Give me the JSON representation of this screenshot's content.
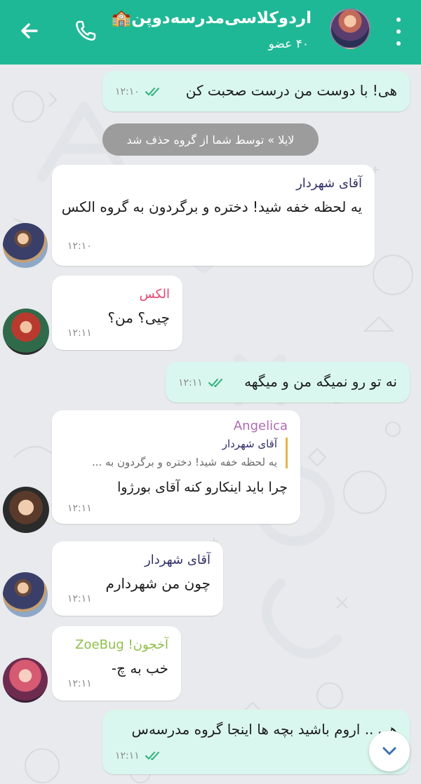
{
  "header": {
    "title": "اردوکلاسی‌مدرسه‌دوپن🏫",
    "subtitle": "۴۰ عضو",
    "colors": {
      "bar": "#1fb896"
    }
  },
  "system_message": "لایلا » توسط شما از گروه حذف شد",
  "messages": [
    {
      "type": "outgoing",
      "text": "هی! با دوست من درست صحبت کن",
      "time": "۱۲:۱۰"
    },
    {
      "type": "incoming",
      "sender": "آقای شهردار",
      "sender_color": "#2f2f6a",
      "text": "یه لحظه خفه شید! دختره و برگردون به گروه الکس",
      "time": "۱۲:۱۰"
    },
    {
      "type": "incoming",
      "sender": "الکس",
      "sender_color": "#e2456f",
      "text": "چیی؟ من؟",
      "time": "۱۲:۱۱"
    },
    {
      "type": "outgoing",
      "text": "نه تو رو نمیگه من و میگهه",
      "time": "۱۲:۱۱"
    },
    {
      "type": "incoming",
      "sender": "Angelica",
      "sender_color": "#b06ab3",
      "quote_sender": "آقای شهردار",
      "quote_text": "یه لحظه خفه شید! دختره و برگردون به ...",
      "text": "چرا باید اینکارو کنه آقای بورژوا",
      "time": "۱۲:۱۱"
    },
    {
      "type": "incoming",
      "sender": "آقای شهردار",
      "sender_color": "#2f2f6a",
      "text": "چون من شهردارم",
      "time": "۱۲:۱۱"
    },
    {
      "type": "incoming",
      "sender": "ZoeBug",
      "sender_prefix": "آخجون!",
      "sender_color": "#8fbf4a",
      "text": "خب به چ-",
      "time": "۱۲:۱۱"
    },
    {
      "type": "outgoing",
      "text": "هی .. اروم باشید بچه ها اینجا گروه مدرسه‌س",
      "time": "۱۲:۱۱"
    }
  ],
  "icons": {
    "back": "arrow-left-icon",
    "call": "phone-icon",
    "menu": "more-vertical-icon",
    "scroll": "chevron-down-icon",
    "read": "double-check-icon"
  },
  "colors": {
    "outgoing_bubble": "#d9f7ee",
    "incoming_bubble": "#ffffff",
    "read_tick": "#2fb07a"
  }
}
